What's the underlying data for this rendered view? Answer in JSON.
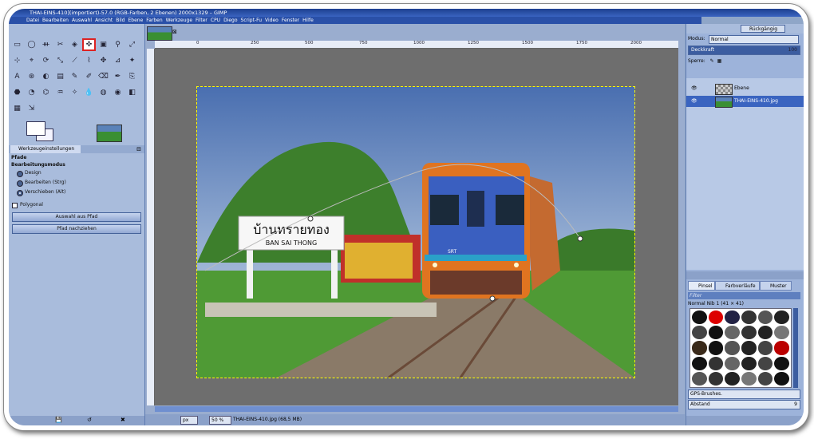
{
  "window": {
    "title": "THAI-EINS-410](importiert)-57.0 (RGB-Farben, 2 Ebenen) 2000x1329 – GIMP"
  },
  "menu": [
    "Datei",
    "Bearbeiten",
    "Auswahl",
    "Ansicht",
    "Bild",
    "Ebene",
    "Farben",
    "Werkzeuge",
    "Filter",
    "CPU",
    "Diego",
    "Script-Fu",
    "Video",
    "Fenster",
    "Hilfe"
  ],
  "tool_options": {
    "tab_label": "Werkzeugeinstellungen",
    "section": "Pfade",
    "mode_heading": "Bearbeitungsmodus",
    "modes": [
      "Design",
      "Bearbeiten (Strg)",
      "Verschieben (Alt)"
    ],
    "selected_mode": "Verschieben (Alt)",
    "polygonal_label": "Polygonal",
    "btn_selection_from_path": "Auswahl aus Pfad",
    "btn_stroke_path": "Pfad nachziehen"
  },
  "ruler": {
    "ticks": [
      "0",
      "250",
      "500",
      "750",
      "1000",
      "1250",
      "1500",
      "1750",
      "2000"
    ]
  },
  "photo": {
    "sign_thai": "บ้านทรายทอง",
    "sign_latin": "BAN SAI THONG",
    "train_logo": "SRT"
  },
  "status": {
    "unit": "px",
    "zoom": "50 %",
    "file_info": "THAI-EINS-410.jpg (68,5 MB)"
  },
  "layers_dock": {
    "undo_label": "Rückgängig",
    "mode_label": "Modus:",
    "mode_value": "Normal",
    "opacity_label": "Deckkraft",
    "opacity_value": "100",
    "opacity_fraction": 1.0,
    "lock_label": "Sperre:",
    "layers": [
      {
        "name": "Ebene",
        "selected": false
      },
      {
        "name": "THAI-EINS-410.jpg",
        "selected": true
      }
    ],
    "brush_tabs": [
      "Pinsel",
      "Farbverläufe",
      "Muster"
    ],
    "filter_placeholder": "Filter",
    "brush_name": "Normal Nib 1 (41 × 41)",
    "brush_set": "GPS-Brushes.",
    "spacing_label": "Abstand",
    "spacing_value": "9"
  },
  "colors": {
    "title_bar": "#1d3f8f",
    "accent": "#3a64c0",
    "tool_highlight": "#dd2222"
  }
}
